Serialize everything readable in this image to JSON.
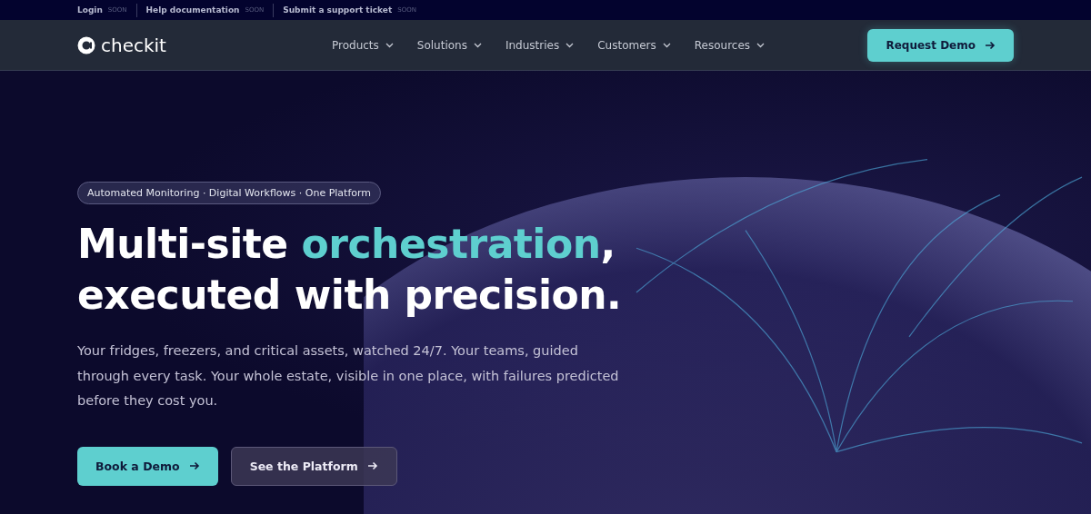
{
  "top_bar": {
    "links": [
      {
        "label": "Login",
        "badge": "SOON"
      },
      {
        "label": "Help documentation",
        "badge": "SOON"
      },
      {
        "label": "Submit a support ticket",
        "badge": "SOON"
      }
    ]
  },
  "nav": {
    "logo": "checkit",
    "items": [
      {
        "label": "Products"
      },
      {
        "label": "Solutions"
      },
      {
        "label": "Industries"
      },
      {
        "label": "Customers"
      },
      {
        "label": "Resources"
      }
    ],
    "cta": "Request Demo"
  },
  "hero": {
    "tagline": "Automated Monitoring · Digital Workflows · One Platform",
    "headline": [
      {
        "text": "Multi-site ",
        "highlight": false
      },
      {
        "text": "orchestration",
        "highlight": true
      },
      {
        "text": ",",
        "highlight": false
      },
      {
        "text": "executed with precision.",
        "highlight": false,
        "break_before": true
      }
    ],
    "description": "Your fridges, freezers, and critical assets, watched 24/7. Your teams, guided through every task. Your whole estate, visible in one place, with failures predicted before they cost you.",
    "buttons": [
      {
        "label": "Book a Demo",
        "kind": "primary"
      },
      {
        "label": "See the Platform",
        "kind": "secondary"
      }
    ]
  }
}
